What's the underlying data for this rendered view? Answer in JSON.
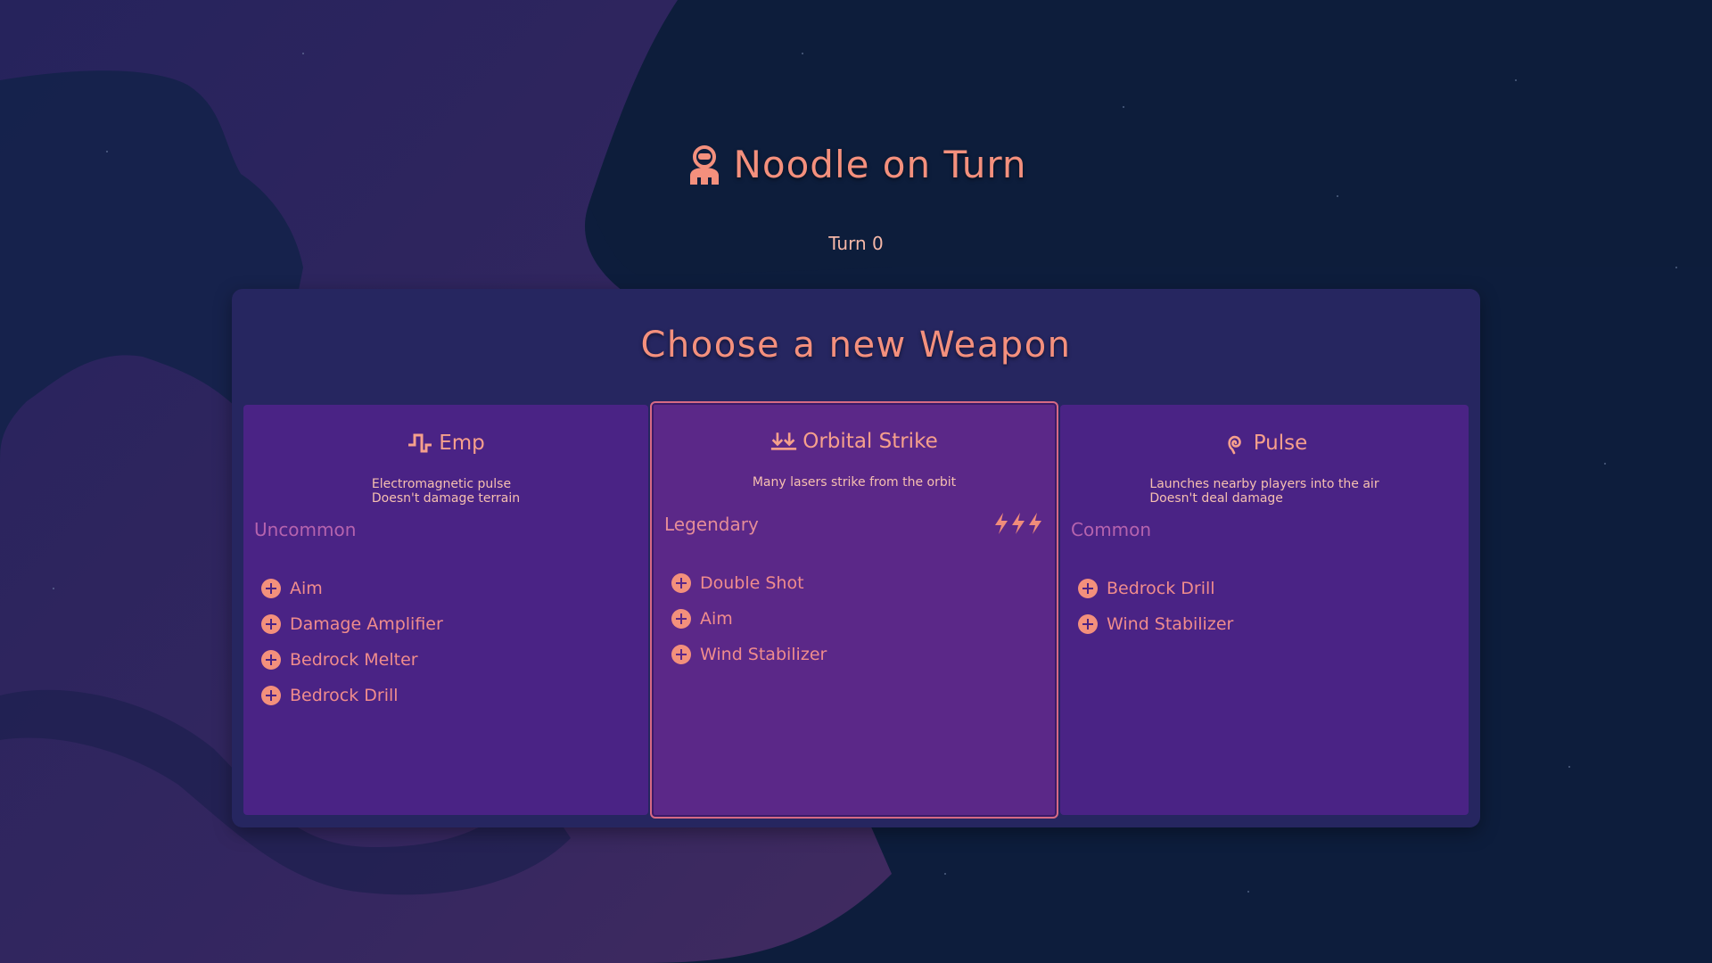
{
  "header": {
    "player_name": "Noodle on Turn",
    "player_icon": "astronaut-icon",
    "turn": "Turn 0"
  },
  "panel": {
    "title": "Choose a new Weapon"
  },
  "weapons": [
    {
      "name": "Emp",
      "icon": "pulse-wave-icon",
      "description": [
        "Electromagnetic pulse",
        "Doesn't damage terrain"
      ],
      "rarity": "Uncommon",
      "upgrades": [
        "Aim",
        "Damage Amplifier",
        "Bedrock Melter",
        "Bedrock Drill"
      ]
    },
    {
      "name": "Orbital Strike",
      "icon": "double-down-arrow-icon",
      "description": [
        "Many lasers strike from the orbit"
      ],
      "rarity": "Legendary",
      "rarity_icon": "triple-lightning-icon",
      "selected": true,
      "upgrades": [
        "Double Shot",
        "Aim",
        "Wind Stabilizer"
      ]
    },
    {
      "name": "Pulse",
      "icon": "spiral-icon",
      "description": [
        "Launches nearby players into the air",
        "Doesn't deal damage"
      ],
      "rarity": "Common",
      "upgrades": [
        "Bedrock Drill",
        "Wind Stabilizer"
      ]
    }
  ],
  "colors": {
    "background": "#0c1c3a",
    "panel": "#262660",
    "card": "#4a2385",
    "card_selected": "#5b2888",
    "accent": "#f4907d"
  }
}
